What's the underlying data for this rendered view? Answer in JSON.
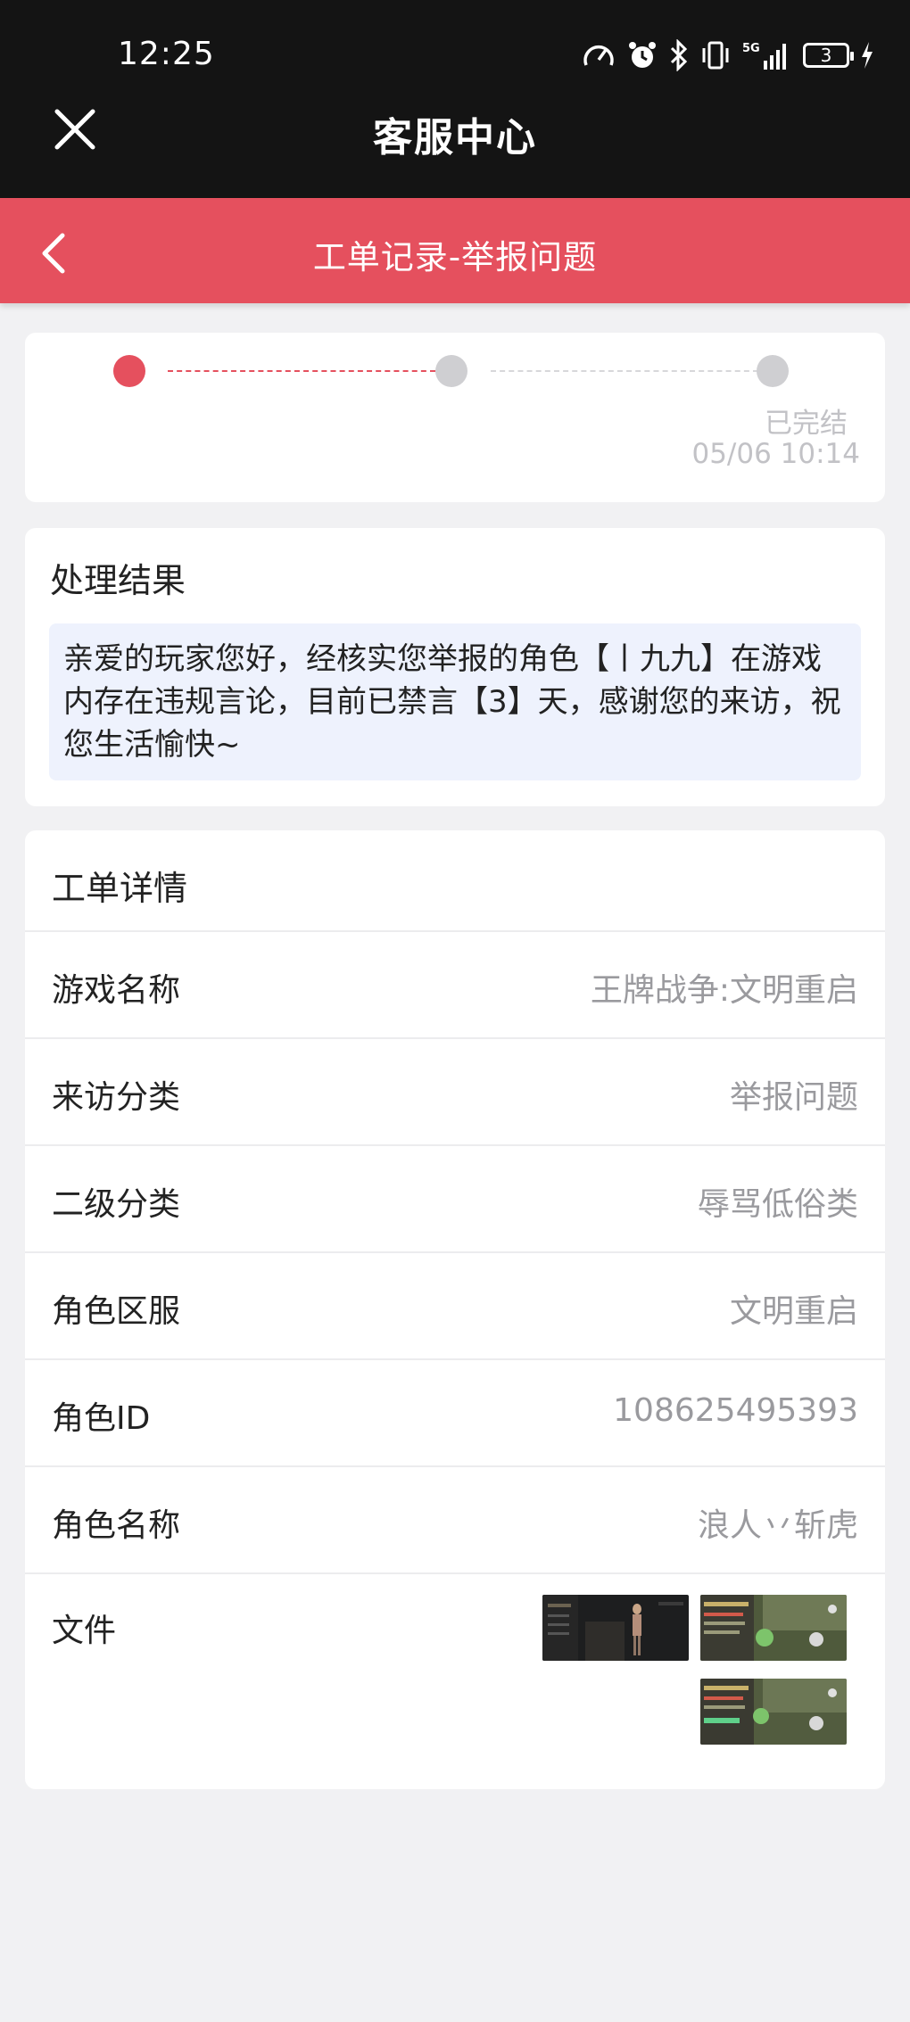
{
  "status_bar": {
    "time": "12:25",
    "battery": "3",
    "network": "5G"
  },
  "app_header": {
    "title": "客服中心",
    "close_icon": "close-icon"
  },
  "nav": {
    "title": "工单记录-举报问题",
    "back_icon": "back-arrow-icon"
  },
  "progress": {
    "steps": [
      {
        "state": "active",
        "color": "#e5505e"
      },
      {
        "state": "pending",
        "color": "#cfcfd2"
      },
      {
        "state": "pending",
        "color": "#cfcfd2"
      }
    ],
    "final_status": "已完结",
    "final_time": "05/06 10:14"
  },
  "result": {
    "title": "处理结果",
    "message": "亲爱的玩家您好，经核实您举报的角色【丨九九】在游戏内存在违规言论，目前已禁言【3】天，感谢您的来访，祝您生活愉快~"
  },
  "details": {
    "title": "工单详情",
    "rows": [
      {
        "label": "游戏名称",
        "value": "王牌战争:文明重启"
      },
      {
        "label": "来访分类",
        "value": "举报问题"
      },
      {
        "label": "二级分类",
        "value": "辱骂低俗类"
      },
      {
        "label": "角色区服",
        "value": "文明重启"
      },
      {
        "label": "角色ID",
        "value": "108625495393"
      },
      {
        "label": "角色名称",
        "value": "浪人丷斩虎"
      }
    ],
    "files_label": "文件",
    "files": [
      "screenshot-1",
      "screenshot-2",
      "screenshot-3"
    ]
  },
  "colors": {
    "accent": "#e5505e",
    "header_bg": "#141414",
    "page_bg": "#f1f1f3",
    "result_bg": "#eef2fd"
  }
}
